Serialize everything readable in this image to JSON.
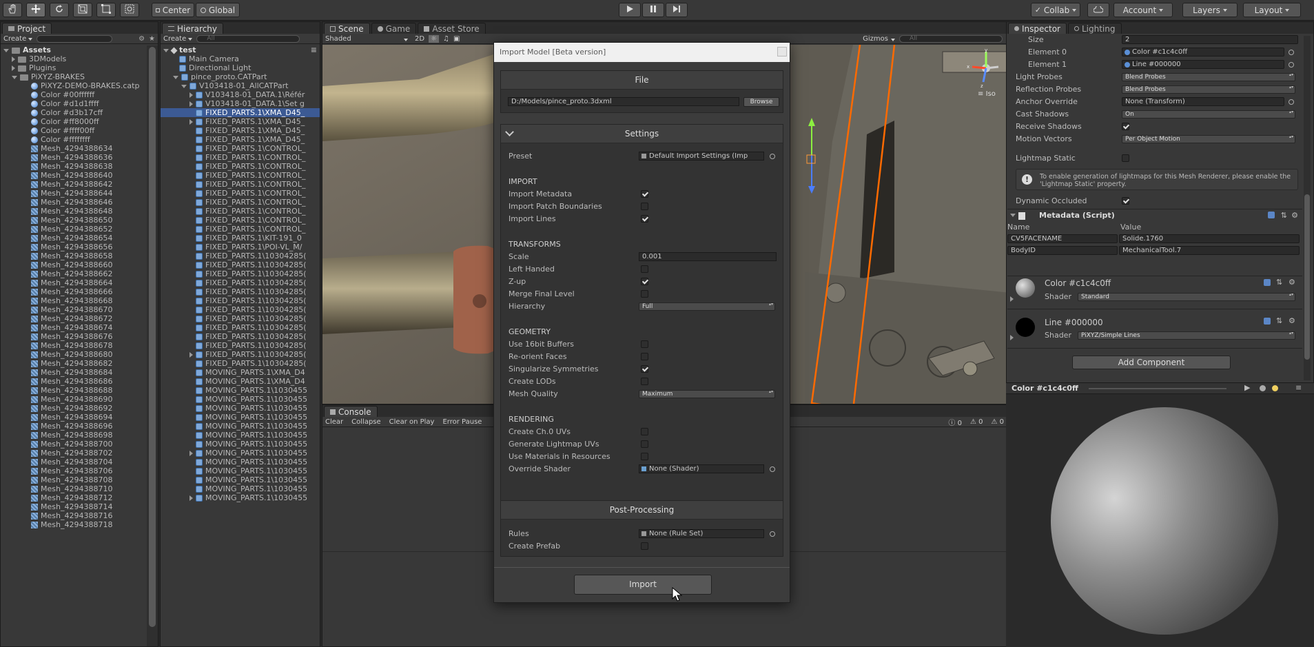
{
  "toolbar": {
    "pivot_center": "Center",
    "pivot_global": "Global",
    "collab": "Collab",
    "account": "Account",
    "layers": "Layers",
    "layout": "Layout"
  },
  "project": {
    "tab": "Project",
    "create": "Create",
    "assets": "Assets",
    "folders": [
      "3DModels",
      "Plugins"
    ],
    "pixyz_folder": "PiXYZ-BRAKES",
    "items": [
      {
        "label": "PiXYZ-DEMO-BRAKES.catp",
        "icon": "ball"
      },
      {
        "label": "Color #00ffffff",
        "icon": "ball"
      },
      {
        "label": "Color #d1d1ffff",
        "icon": "ball"
      },
      {
        "label": "Color #d3b17cff",
        "icon": "ball"
      },
      {
        "label": "Color #ff8000ff",
        "icon": "ball"
      },
      {
        "label": "Color #ffff00ff",
        "icon": "ball"
      },
      {
        "label": "Color #ffffffff",
        "icon": "ball"
      },
      {
        "label": "Mesh_4294388634",
        "icon": "mesh"
      },
      {
        "label": "Mesh_4294388636",
        "icon": "mesh"
      },
      {
        "label": "Mesh_4294388638",
        "icon": "mesh"
      },
      {
        "label": "Mesh_4294388640",
        "icon": "mesh"
      },
      {
        "label": "Mesh_4294388642",
        "icon": "mesh"
      },
      {
        "label": "Mesh_4294388644",
        "icon": "mesh"
      },
      {
        "label": "Mesh_4294388646",
        "icon": "mesh"
      },
      {
        "label": "Mesh_4294388648",
        "icon": "mesh"
      },
      {
        "label": "Mesh_4294388650",
        "icon": "mesh"
      },
      {
        "label": "Mesh_4294388652",
        "icon": "mesh"
      },
      {
        "label": "Mesh_4294388654",
        "icon": "mesh"
      },
      {
        "label": "Mesh_4294388656",
        "icon": "mesh"
      },
      {
        "label": "Mesh_4294388658",
        "icon": "mesh"
      },
      {
        "label": "Mesh_4294388660",
        "icon": "mesh"
      },
      {
        "label": "Mesh_4294388662",
        "icon": "mesh"
      },
      {
        "label": "Mesh_4294388664",
        "icon": "mesh"
      },
      {
        "label": "Mesh_4294388666",
        "icon": "mesh"
      },
      {
        "label": "Mesh_4294388668",
        "icon": "mesh"
      },
      {
        "label": "Mesh_4294388670",
        "icon": "mesh"
      },
      {
        "label": "Mesh_4294388672",
        "icon": "mesh"
      },
      {
        "label": "Mesh_4294388674",
        "icon": "mesh"
      },
      {
        "label": "Mesh_4294388676",
        "icon": "mesh"
      },
      {
        "label": "Mesh_4294388678",
        "icon": "mesh"
      },
      {
        "label": "Mesh_4294388680",
        "icon": "mesh"
      },
      {
        "label": "Mesh_4294388682",
        "icon": "mesh"
      },
      {
        "label": "Mesh_4294388684",
        "icon": "mesh"
      },
      {
        "label": "Mesh_4294388686",
        "icon": "mesh"
      },
      {
        "label": "Mesh_4294388688",
        "icon": "mesh"
      },
      {
        "label": "Mesh_4294388690",
        "icon": "mesh"
      },
      {
        "label": "Mesh_4294388692",
        "icon": "mesh"
      },
      {
        "label": "Mesh_4294388694",
        "icon": "mesh"
      },
      {
        "label": "Mesh_4294388696",
        "icon": "mesh"
      },
      {
        "label": "Mesh_4294388698",
        "icon": "mesh"
      },
      {
        "label": "Mesh_4294388700",
        "icon": "mesh"
      },
      {
        "label": "Mesh_4294388702",
        "icon": "mesh"
      },
      {
        "label": "Mesh_4294388704",
        "icon": "mesh"
      },
      {
        "label": "Mesh_4294388706",
        "icon": "mesh"
      },
      {
        "label": "Mesh_4294388708",
        "icon": "mesh"
      },
      {
        "label": "Mesh_4294388710",
        "icon": "mesh"
      },
      {
        "label": "Mesh_4294388712",
        "icon": "mesh"
      },
      {
        "label": "Mesh_4294388714",
        "icon": "mesh"
      },
      {
        "label": "Mesh_4294388716",
        "icon": "mesh"
      },
      {
        "label": "Mesh_4294388718",
        "icon": "mesh"
      }
    ]
  },
  "hierarchy": {
    "tab": "Hierarchy",
    "create": "Create",
    "search_placeholder": "All",
    "scene_name": "test",
    "rows": [
      {
        "label": "Main Camera",
        "indent": 1,
        "fold": "",
        "selected": false
      },
      {
        "label": "Directional Light",
        "indent": 1,
        "fold": "",
        "selected": false
      },
      {
        "label": "pince_proto.CATPart",
        "indent": 1,
        "fold": "open",
        "selected": false
      },
      {
        "label": "V103418-01_AllCATPart",
        "indent": 2,
        "fold": "open",
        "selected": false
      },
      {
        "label": "V103418-01_DATA.1\\Référ",
        "indent": 3,
        "fold": "closed",
        "selected": false
      },
      {
        "label": "V103418-01_DATA.1\\Set g",
        "indent": 3,
        "fold": "closed",
        "selected": false
      },
      {
        "label": "FIXED_PARTS.1\\XMA_D45_",
        "indent": 3,
        "fold": "",
        "selected": true
      },
      {
        "label": "FIXED_PARTS.1\\XMA_D45_",
        "indent": 3,
        "fold": "closed",
        "selected": false
      },
      {
        "label": "FIXED_PARTS.1\\XMA_D45_",
        "indent": 3,
        "fold": "",
        "selected": false
      },
      {
        "label": "FIXED_PARTS.1\\XMA_D45_",
        "indent": 3,
        "fold": "",
        "selected": false
      },
      {
        "label": "FIXED_PARTS.1\\CONTROL_",
        "indent": 3,
        "fold": "",
        "selected": false
      },
      {
        "label": "FIXED_PARTS.1\\CONTROL_",
        "indent": 3,
        "fold": "",
        "selected": false
      },
      {
        "label": "FIXED_PARTS.1\\CONTROL_",
        "indent": 3,
        "fold": "",
        "selected": false
      },
      {
        "label": "FIXED_PARTS.1\\CONTROL_",
        "indent": 3,
        "fold": "",
        "selected": false
      },
      {
        "label": "FIXED_PARTS.1\\CONTROL_",
        "indent": 3,
        "fold": "",
        "selected": false
      },
      {
        "label": "FIXED_PARTS.1\\CONTROL_",
        "indent": 3,
        "fold": "",
        "selected": false
      },
      {
        "label": "FIXED_PARTS.1\\CONTROL_",
        "indent": 3,
        "fold": "",
        "selected": false
      },
      {
        "label": "FIXED_PARTS.1\\CONTROL_",
        "indent": 3,
        "fold": "",
        "selected": false
      },
      {
        "label": "FIXED_PARTS.1\\CONTROL_",
        "indent": 3,
        "fold": "",
        "selected": false
      },
      {
        "label": "FIXED_PARTS.1\\CONTROL_",
        "indent": 3,
        "fold": "",
        "selected": false
      },
      {
        "label": "FIXED_PARTS.1\\KIT-191_0",
        "indent": 3,
        "fold": "",
        "selected": false
      },
      {
        "label": "FIXED_PARTS.1\\POI-VL_M/",
        "indent": 3,
        "fold": "",
        "selected": false
      },
      {
        "label": "FIXED_PARTS.1\\10304285(",
        "indent": 3,
        "fold": "",
        "selected": false
      },
      {
        "label": "FIXED_PARTS.1\\10304285(",
        "indent": 3,
        "fold": "",
        "selected": false
      },
      {
        "label": "FIXED_PARTS.1\\10304285(",
        "indent": 3,
        "fold": "",
        "selected": false
      },
      {
        "label": "FIXED_PARTS.1\\10304285(",
        "indent": 3,
        "fold": "",
        "selected": false
      },
      {
        "label": "FIXED_PARTS.1\\10304285(",
        "indent": 3,
        "fold": "",
        "selected": false
      },
      {
        "label": "FIXED_PARTS.1\\10304285(",
        "indent": 3,
        "fold": "",
        "selected": false
      },
      {
        "label": "FIXED_PARTS.1\\10304285(",
        "indent": 3,
        "fold": "",
        "selected": false
      },
      {
        "label": "FIXED_PARTS.1\\10304285(",
        "indent": 3,
        "fold": "",
        "selected": false
      },
      {
        "label": "FIXED_PARTS.1\\10304285(",
        "indent": 3,
        "fold": "",
        "selected": false
      },
      {
        "label": "FIXED_PARTS.1\\10304285(",
        "indent": 3,
        "fold": "",
        "selected": false
      },
      {
        "label": "FIXED_PARTS.1\\10304285(",
        "indent": 3,
        "fold": "",
        "selected": false
      },
      {
        "label": "FIXED_PARTS.1\\10304285(",
        "indent": 3,
        "fold": "closed",
        "selected": false
      },
      {
        "label": "FIXED_PARTS.1\\10304285(",
        "indent": 3,
        "fold": "",
        "selected": false
      },
      {
        "label": "MOVING_PARTS.1\\XMA_D4",
        "indent": 3,
        "fold": "",
        "selected": false
      },
      {
        "label": "MOVING_PARTS.1\\XMA_D4",
        "indent": 3,
        "fold": "",
        "selected": false
      },
      {
        "label": "MOVING_PARTS.1\\1030455",
        "indent": 3,
        "fold": "",
        "selected": false
      },
      {
        "label": "MOVING_PARTS.1\\1030455",
        "indent": 3,
        "fold": "",
        "selected": false
      },
      {
        "label": "MOVING_PARTS.1\\1030455",
        "indent": 3,
        "fold": "",
        "selected": false
      },
      {
        "label": "MOVING_PARTS.1\\1030455",
        "indent": 3,
        "fold": "",
        "selected": false
      },
      {
        "label": "MOVING_PARTS.1\\1030455",
        "indent": 3,
        "fold": "",
        "selected": false
      },
      {
        "label": "MOVING_PARTS.1\\1030455",
        "indent": 3,
        "fold": "",
        "selected": false
      },
      {
        "label": "MOVING_PARTS.1\\1030455",
        "indent": 3,
        "fold": "",
        "selected": false
      },
      {
        "label": "MOVING_PARTS.1\\1030455",
        "indent": 3,
        "fold": "closed",
        "selected": false
      },
      {
        "label": "MOVING_PARTS.1\\1030455",
        "indent": 3,
        "fold": "",
        "selected": false
      },
      {
        "label": "MOVING_PARTS.1\\1030455",
        "indent": 3,
        "fold": "",
        "selected": false
      },
      {
        "label": "MOVING_PARTS.1\\1030455",
        "indent": 3,
        "fold": "",
        "selected": false
      },
      {
        "label": "MOVING_PARTS.1\\1030455",
        "indent": 3,
        "fold": "",
        "selected": false
      },
      {
        "label": "MOVING_PARTS.1\\1030455",
        "indent": 3,
        "fold": "closed",
        "selected": false
      }
    ]
  },
  "scene": {
    "tabs": [
      "Scene",
      "Game",
      "Asset Store"
    ],
    "shaded": "Shaded",
    "two_d": "2D",
    "gizmos": "Gizmos",
    "search_placeholder": "All",
    "iso": "Iso"
  },
  "console": {
    "tab": "Console",
    "buttons": [
      "Clear",
      "Collapse",
      "Clear on Play",
      "Error Pause"
    ],
    "counts": [
      "0",
      "0",
      "0"
    ]
  },
  "inspector": {
    "tabs": [
      "Inspector",
      "Lighting"
    ],
    "size_label": "Size",
    "size_value": "2",
    "element0_label": "Element 0",
    "element0_value": "Color #c1c4c0ff",
    "element1_label": "Element 1",
    "element1_value": "Line #000000",
    "light_probes_label": "Light Probes",
    "light_probes_value": "Blend Probes",
    "reflection_probes_label": "Reflection Probes",
    "reflection_probes_value": "Blend Probes",
    "anchor_override_label": "Anchor Override",
    "anchor_override_value": "None (Transform)",
    "cast_shadows_label": "Cast Shadows",
    "cast_shadows_value": "On",
    "receive_shadows_label": "Receive Shadows",
    "receive_shadows_checked": true,
    "motion_vectors_label": "Motion Vectors",
    "motion_vectors_value": "Per Object Motion",
    "lightmap_static_label": "Lightmap Static",
    "lightmap_static_checked": false,
    "lightmap_info": "To enable generation of lightmaps for this Mesh Renderer, please enable the 'Lightmap Static' property.",
    "dynamic_occluded_label": "Dynamic Occluded",
    "dynamic_occluded_checked": true,
    "metadata_title": "Metadata (Script)",
    "metadata_headers": [
      "Name",
      "Value"
    ],
    "metadata_rows": [
      {
        "name": "CV5FACENAME",
        "value": "Solide.1760"
      },
      {
        "name": "BodyID",
        "value": "MechanicalTool.7"
      }
    ],
    "material1_name": "Color #c1c4c0ff",
    "material1_shader_label": "Shader",
    "material1_shader": "Standard",
    "material2_name": "Line #000000",
    "material2_shader_label": "Shader",
    "material2_shader": "PiXYZ/Simple Lines",
    "add_component": "Add Component",
    "preview_title": "Color #c1c4c0ff"
  },
  "dialog": {
    "title": "Import Model [Beta version]",
    "file_header": "File",
    "file_path": "D:/Models/pince_proto.3dxml",
    "browse": "Browse",
    "settings_header": "Settings",
    "preset_label": "Preset",
    "preset_value": "Default Import Settings (Imp",
    "import_group": "IMPORT",
    "import_metadata": "Import Metadata",
    "import_metadata_checked": true,
    "import_patch_boundaries": "Import Patch Boundaries",
    "import_patch_boundaries_checked": false,
    "import_lines": "Import Lines",
    "import_lines_checked": true,
    "transforms_group": "TRANSFORMS",
    "scale_label": "Scale",
    "scale_value": "0.001",
    "left_handed": "Left Handed",
    "left_handed_checked": false,
    "z_up": "Z-up",
    "z_up_checked": true,
    "merge_final_level": "Merge Final Level",
    "merge_final_level_checked": false,
    "hierarchy_label": "Hierarchy",
    "hierarchy_value": "Full",
    "geometry_group": "GEOMETRY",
    "use_16bit": "Use 16bit Buffers",
    "use_16bit_checked": false,
    "reorient_faces": "Re-orient Faces",
    "reorient_faces_checked": false,
    "singularize": "Singularize Symmetries",
    "singularize_checked": true,
    "create_lods": "Create LODs",
    "create_lods_checked": false,
    "mesh_quality_label": "Mesh Quality",
    "mesh_quality_value": "Maximum",
    "rendering_group": "RENDERING",
    "create_uvs": "Create Ch.0 UVs",
    "create_uvs_checked": false,
    "gen_lightmap_uvs": "Generate Lightmap UVs",
    "gen_lightmap_uvs_checked": false,
    "use_materials": "Use Materials in Resources",
    "use_materials_checked": false,
    "override_shader_label": "Override Shader",
    "override_shader_value": "None (Shader)",
    "postprocessing_header": "Post-Processing",
    "rules_label": "Rules",
    "rules_value": "None (Rule Set)",
    "create_prefab": "Create Prefab",
    "create_prefab_checked": false,
    "import_button": "Import"
  }
}
